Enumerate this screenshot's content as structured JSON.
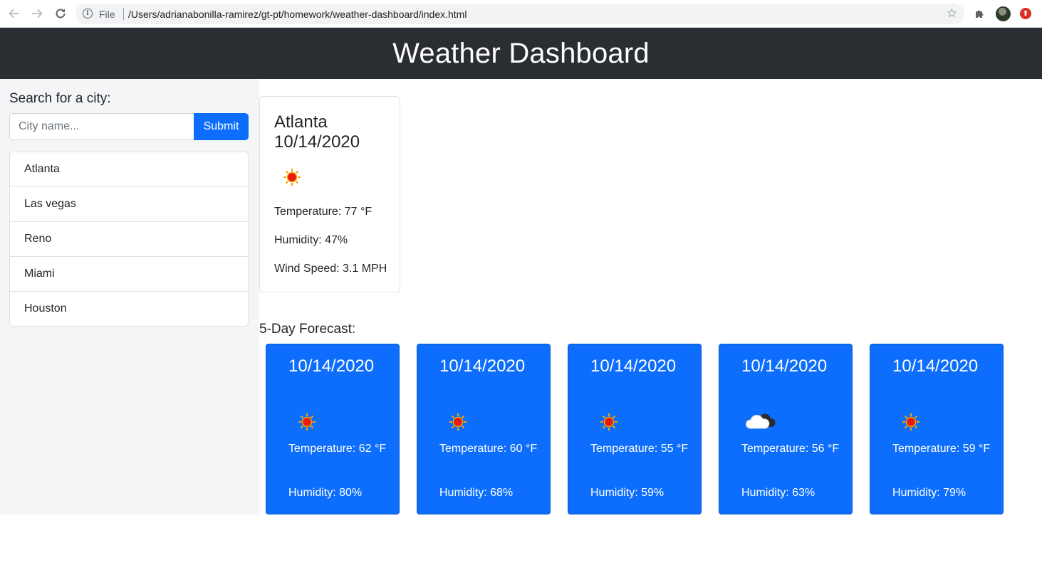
{
  "browser": {
    "scheme_label": "File",
    "url": "/Users/adrianabonilla-ramirez/gt-pt/homework/weather-dashboard/index.html",
    "icons": [
      "back-arrow-icon",
      "forward-arrow-icon",
      "reload-icon",
      "info-icon",
      "star-icon",
      "puzzle-icon",
      "avatar",
      "update-icon"
    ]
  },
  "header": {
    "title": "Weather Dashboard"
  },
  "sidebar": {
    "search_label": "Search for a city:",
    "search_placeholder": "City name...",
    "submit_label": "Submit",
    "cities": [
      "Atlanta",
      "Las vegas",
      "Reno",
      "Miami",
      "Houston"
    ]
  },
  "current": {
    "city_date": "Atlanta\n10/14/2020",
    "icon": "sun-icon",
    "temperature": "Temperature: 77 °F",
    "humidity": "Humidity: 47%",
    "wind": "Wind Speed: 3.1 MPH"
  },
  "forecast": {
    "title": "5-Day Forecast:",
    "days": [
      {
        "date": "10/14/2020",
        "icon": "sun-icon",
        "temperature": "Temperature: 62 °F",
        "humidity": "Humidity: 80%"
      },
      {
        "date": "10/14/2020",
        "icon": "sun-icon",
        "temperature": "Temperature: 60 °F",
        "humidity": "Humidity: 68%"
      },
      {
        "date": "10/14/2020",
        "icon": "sun-icon",
        "temperature": "Temperature: 55 °F",
        "humidity": "Humidity: 59%"
      },
      {
        "date": "10/14/2020",
        "icon": "cloud-icon",
        "temperature": "Temperature: 56 °F",
        "humidity": "Humidity: 63%"
      },
      {
        "date": "10/14/2020",
        "icon": "sun-icon",
        "temperature": "Temperature: 59 °F",
        "humidity": "Humidity: 79%"
      }
    ]
  },
  "colors": {
    "header_bg": "#2a2d31",
    "primary": "#0d6efd",
    "sidebar_bg": "#f4f5f7"
  }
}
